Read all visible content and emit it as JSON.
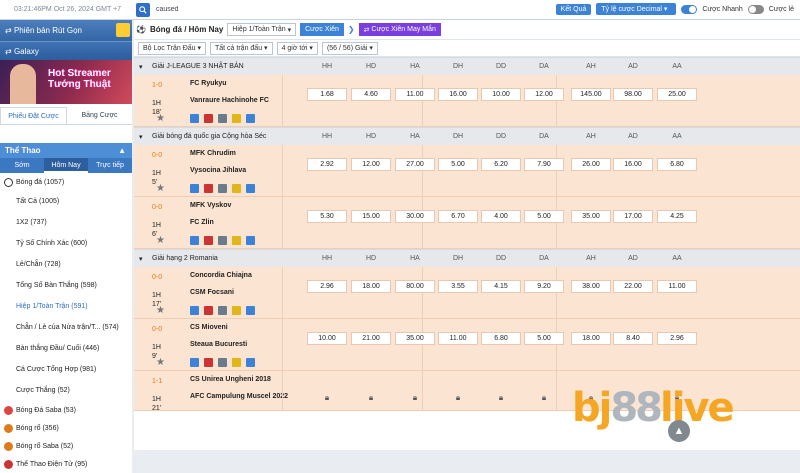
{
  "topbar": {
    "clock": "03:21:46PM Oct 26, 2024 GMT +7",
    "search_value": "caused",
    "ket_qua": "Kết Quả",
    "odds_type": "Tỷ lệ cược Decimal",
    "cuoc_nhanh": "Cược Nhanh",
    "cuoc_le": "Cược lẻ"
  },
  "sidebar": {
    "promo1": "Phiên bản Rút Gọn",
    "promo2": "Galaxy",
    "banner_title": "Hot Streamer",
    "banner_sub": "Tướng Thuật",
    "tab_left": "Phiếu Đặt Cược",
    "tab_right": "Bảng Cược",
    "sport_header": "Thể Thao",
    "subtab1": "Sớm",
    "subtab2": "Hôm Nay",
    "subtab3": "Trực tiếp",
    "items": [
      {
        "label": "Bóng đá (1057)"
      },
      {
        "label": "Tất Cả (1005)"
      },
      {
        "label": "1X2 (737)"
      },
      {
        "label": "Tỷ Số Chính Xác (600)"
      },
      {
        "label": "Lẻ/Chẵn (728)"
      },
      {
        "label": "Tổng Số Bàn Thắng (598)"
      },
      {
        "label": "Hiệp 1/Toàn Trận (591)"
      },
      {
        "label": "Chẵn / Lẻ của Nửa trận/T... (574)"
      },
      {
        "label": "Bàn thắng Đầu/ Cuối (446)"
      },
      {
        "label": "Cá Cược Tổng Hợp (981)"
      },
      {
        "label": "Cược Thắng (52)"
      },
      {
        "label": "Bóng Đá Saba (53)"
      },
      {
        "label": "Bóng rổ (356)"
      },
      {
        "label": "Bóng rổ Saba (52)"
      },
      {
        "label": "Thể Thao Điện Tử (95)"
      }
    ]
  },
  "main": {
    "crumb": "Bóng đá / Hôm Nay",
    "period_sel": "Hiệp 1/Toàn Trận",
    "cuoc_xien": "Cược Xiên",
    "cuoc_xien_may_man": "Cược Xiên May Mắn",
    "filter1": "Bộ Lọc Trận Đấu",
    "filter2": "Tất cả trận đấu",
    "filter3": "4 giờ tới",
    "filter4": "(56 / 56) Giải",
    "cols": [
      "HH",
      "HD",
      "HA",
      "DH",
      "DD",
      "DA",
      "AH",
      "AD",
      "AA"
    ],
    "leagues": [
      {
        "name": "Giải J-LEAGUE 3 NHẬT BẢN"
      },
      {
        "name": "Giải bóng đá quốc gia Cộng hòa Séc"
      },
      {
        "name": "Giải hạng 2 Romania"
      }
    ],
    "matches": [
      {
        "score": "1-0",
        "half": "1H",
        "min": "18'",
        "home": "FC Ryukyu",
        "away": "Vanraure Hachinohe FC",
        "odds": [
          "1.68",
          "4.60",
          "11.00",
          "16.00",
          "10.00",
          "12.00",
          "145.00",
          "98.00",
          "25.00"
        ]
      },
      {
        "score": "0-0",
        "half": "1H",
        "min": "5'",
        "home": "MFK Chrudim",
        "away": "Vysocina Jihlava",
        "odds": [
          "2.92",
          "12.00",
          "27.00",
          "5.00",
          "6.20",
          "7.90",
          "26.00",
          "16.00",
          "6.80"
        ]
      },
      {
        "score": "0-0",
        "half": "1H",
        "min": "6'",
        "home": "MFK Vyskov",
        "away": "FC Zlin",
        "odds": [
          "5.30",
          "15.00",
          "30.00",
          "6.70",
          "4.00",
          "5.00",
          "35.00",
          "17.00",
          "4.25"
        ]
      },
      {
        "score": "0-0",
        "half": "1H",
        "min": "17'",
        "home": "Concordia Chiajna",
        "away": "CSM Focsani",
        "odds": [
          "2.96",
          "18.00",
          "80.00",
          "3.55",
          "4.15",
          "9.20",
          "38.00",
          "22.00",
          "11.00"
        ]
      },
      {
        "score": "0-0",
        "half": "1H",
        "min": "9'",
        "home": "CS Mioveni",
        "away": "Steaua Bucuresti",
        "odds": [
          "10.00",
          "21.00",
          "35.00",
          "11.00",
          "6.80",
          "5.00",
          "18.00",
          "8.40",
          "2.96"
        ]
      },
      {
        "score": "1-1",
        "half": "1H",
        "min": "21'",
        "home": "CS Unirea Ungheni 2018",
        "away": "AFC Campulung Muscel 2022"
      }
    ]
  },
  "watermark": {
    "p1": "bj",
    "p2": "88",
    "p3": "live",
    "sub": "ONLINE"
  },
  "colors": {
    "accent": "#3c82d6",
    "row": "#fbe4d2",
    "score": "#e07b1a",
    "purple": "#7b3fe0"
  }
}
